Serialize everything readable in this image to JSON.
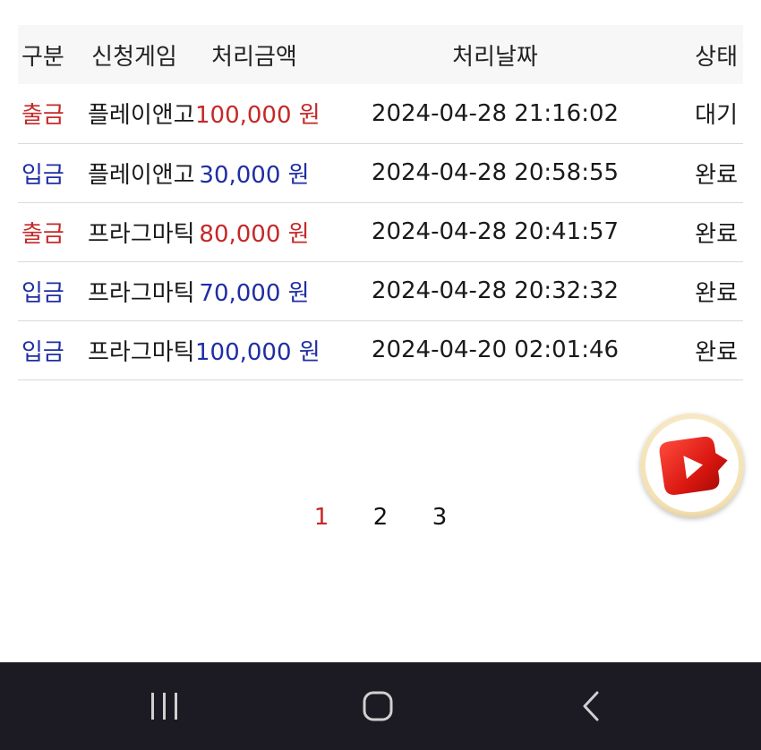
{
  "table": {
    "headers": {
      "type": "구분",
      "game": "신청게임",
      "amount": "처리금액",
      "date": "처리날짜",
      "status": "상태"
    },
    "rows": [
      {
        "type": "출금",
        "game": "플레이앤고",
        "amount": "100,000 원",
        "date": "2024-04-28 21:16:02",
        "status": "대기"
      },
      {
        "type": "입금",
        "game": "플레이앤고",
        "amount": "30,000 원",
        "date": "2024-04-28 20:58:55",
        "status": "완료"
      },
      {
        "type": "출금",
        "game": "프라그마틱",
        "amount": "80,000 원",
        "date": "2024-04-28 20:41:57",
        "status": "완료"
      },
      {
        "type": "입금",
        "game": "프라그마틱",
        "amount": "70,000 원",
        "date": "2024-04-28 20:32:32",
        "status": "완료"
      },
      {
        "type": "입금",
        "game": "프라그마틱",
        "amount": "100,000 원",
        "date": "2024-04-20 02:01:46",
        "status": "완료"
      }
    ]
  },
  "pagination": {
    "pages": [
      "1",
      "2",
      "3"
    ],
    "current": "1"
  },
  "colors": {
    "withdraw": "#c62828",
    "deposit": "#1f2ea3",
    "active_page": "#c62828",
    "nav_bar": "#1c1a22",
    "header_bg": "#f7f7f7"
  },
  "icons": {
    "floating_button": "red-play-button-icon",
    "nav_recent": "recent-apps-icon",
    "nav_home": "home-icon",
    "nav_back": "back-icon"
  }
}
